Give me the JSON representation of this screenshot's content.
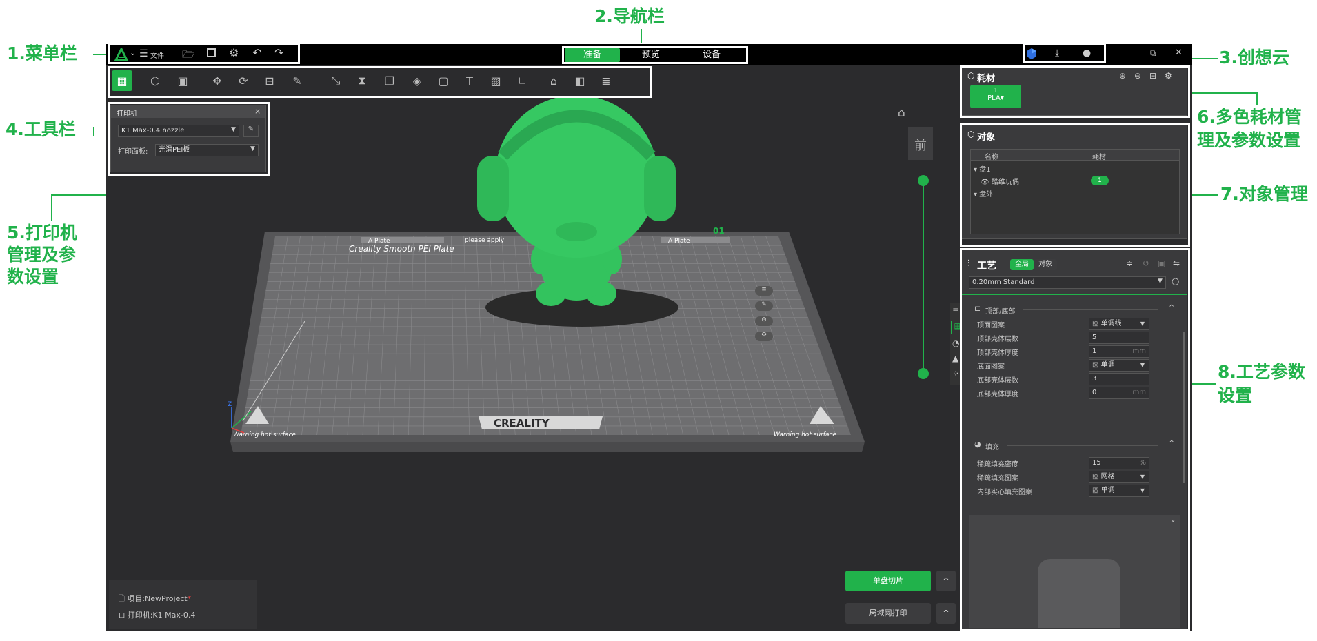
{
  "callouts": {
    "menu": "1.菜单栏",
    "nav": "2.导航栏",
    "cloud": "3.创想云",
    "toolbar": "4.工具栏",
    "printer_a": "5.打印机",
    "printer_b": "管理及参",
    "printer_c": "数设置",
    "filament_a": "6.多色耗材管",
    "filament_b": "理及参数设置",
    "objects": "7.对象管理",
    "process_a": "8.工艺参数",
    "process_b": "设置"
  },
  "menu": {
    "file_label": "文件"
  },
  "nav_tabs": [
    "准备",
    "预览",
    "设备"
  ],
  "printer_panel": {
    "title": "打印机",
    "printer_value": "K1 Max-0.4 nozzle",
    "plate_label": "打印面板:",
    "plate_value": "光滑PEI板"
  },
  "filament_panel": {
    "title": "耗材",
    "slot_number": "1",
    "slot_type": "PLA"
  },
  "object_panel": {
    "title": "对象",
    "col_name": "名称",
    "col_filament": "耗材",
    "plate1": "盘1",
    "object_name": "酷维玩偶",
    "object_filament": "1",
    "outside": "盘外"
  },
  "process_panel": {
    "title": "工艺",
    "tab_global": "全局",
    "tab_object": "对象",
    "preset": "0.20mm Standard",
    "section_topbottom": "顶部/底部",
    "section_infill": "填充",
    "rows": [
      {
        "label": "顶面图案",
        "value": "单调线",
        "unit": ""
      },
      {
        "label": "顶部壳体层数",
        "value": "5",
        "unit": ""
      },
      {
        "label": "顶部壳体厚度",
        "value": "1",
        "unit": "mm"
      },
      {
        "label": "底面图案",
        "value": "单调",
        "unit": ""
      },
      {
        "label": "底部壳体层数",
        "value": "3",
        "unit": ""
      },
      {
        "label": "底部壳体厚度",
        "value": "0",
        "unit": "mm"
      },
      {
        "label": "稀疏填充密度",
        "value": "15",
        "unit": "%"
      },
      {
        "label": "稀疏填充图案",
        "value": "网格",
        "unit": ""
      },
      {
        "label": "内部实心填充图案",
        "value": "单调",
        "unit": ""
      }
    ]
  },
  "viewport": {
    "plate_number": "01",
    "plate_name_left": "A Plate",
    "plate_name_right": "A Plate",
    "plate_caption": "please apply",
    "bed_title": "Creality Smooth PEI Plate",
    "brand": "CREALITY",
    "warning_left": "Warning hot surface",
    "warning_right": "Warning hot surface",
    "view_cube": "前",
    "axis_z": "Z",
    "model_color": "#33c35e"
  },
  "status": {
    "project": "项目:NewProject",
    "project_mark": "*",
    "printer": "打印机:K1 Max-0.4"
  },
  "buttons": {
    "slice": "单盘切片",
    "print": "局域网打印"
  }
}
